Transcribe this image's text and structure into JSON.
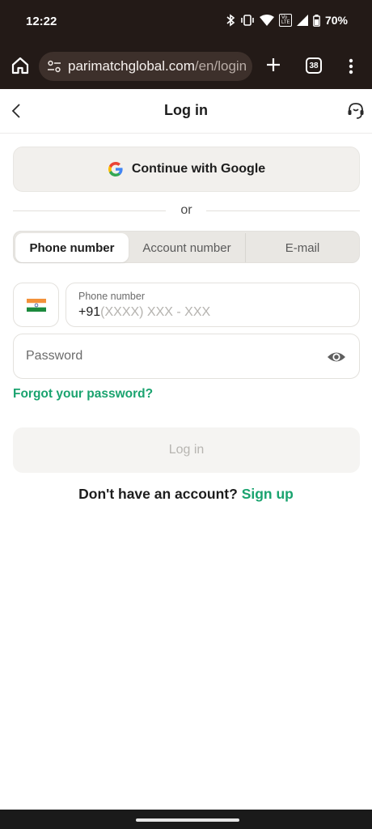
{
  "status_bar": {
    "time": "12:22",
    "icons": [
      "bluetooth-icon",
      "vibrate-icon",
      "wifi-icon",
      "volte-icon",
      "signal-icon",
      "battery-icon"
    ],
    "volte": "Vo LTE",
    "battery": "70%"
  },
  "browser": {
    "url_host": "parimatchglobal.com",
    "url_path": "/en/login",
    "tab_count": "38"
  },
  "header": {
    "title": "Log in"
  },
  "google": {
    "label": "Continue with Google"
  },
  "divider": {
    "text": "or"
  },
  "tabs": {
    "phone": "Phone number",
    "account": "Account number",
    "email": "E-mail"
  },
  "phone": {
    "label": "Phone number",
    "prefix": "+91",
    "mask": "(XXXX) XXX - XXX"
  },
  "password": {
    "placeholder": "Password"
  },
  "forgot": {
    "label": "Forgot your password?"
  },
  "login": {
    "label": "Log in"
  },
  "signup": {
    "question": "Don't have an account?",
    "link": "Sign up"
  },
  "colors": {
    "accent": "#1aa36f",
    "browser_chrome": "#231a17"
  }
}
